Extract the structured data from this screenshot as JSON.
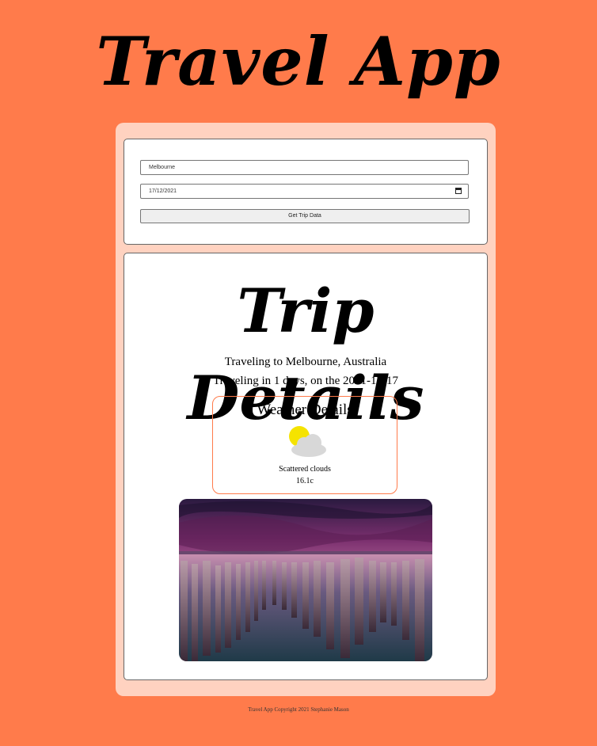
{
  "header": {
    "title": "Travel App"
  },
  "form": {
    "city_value": "Melbourne",
    "date_value": "17/12/2021",
    "submit_label": "Get Trip Data"
  },
  "trip": {
    "title": "Trip Details",
    "destination_text": "Traveling to Melbourne, Australia",
    "days_text": "Traveling in 1 days, on the 2021-12-17"
  },
  "weather": {
    "title": "Weather Details",
    "icon": "partly-cloudy-icon",
    "description": "Scattered clouds",
    "temperature": "16.1c"
  },
  "photo": {
    "icon": "destination-photo"
  },
  "footer": {
    "copyright": "Travel App Copyright 2021 Stephanie Mason"
  },
  "colors": {
    "background": "#ff7b4b",
    "outer_card": "#ffd2c0",
    "sun": "#f5e300",
    "cloud": "#d8d8d8"
  }
}
